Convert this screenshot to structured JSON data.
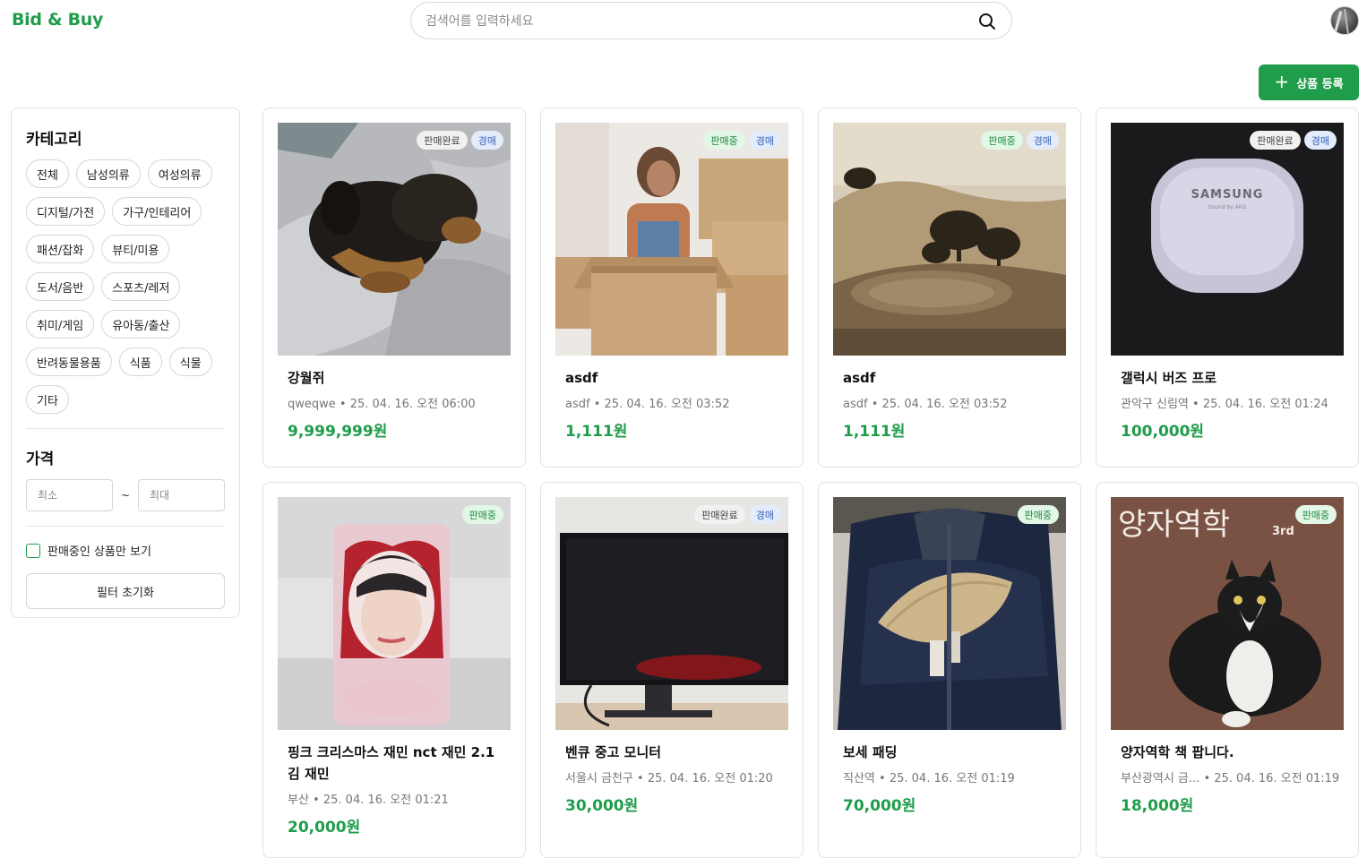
{
  "header": {
    "logo": "Bid & Buy",
    "search_placeholder": "검색어를 입력하세요",
    "search_icon": "search-icon",
    "avatar_icon": "avatar"
  },
  "register_button": {
    "label": "상품 등록",
    "icon": "plus-icon"
  },
  "sidebar": {
    "category_title": "카테고리",
    "categories": [
      "전체",
      "남성의류",
      "여성의류",
      "디지털/가전",
      "가구/인테리어",
      "패션/잡화",
      "뷰티/미용",
      "도서/음반",
      "스포츠/레저",
      "취미/게임",
      "유아동/출산",
      "반려동물용품",
      "식품",
      "식물",
      "기타"
    ],
    "price_title": "가격",
    "price_min_placeholder": "최소",
    "price_max_placeholder": "최대",
    "price_separator": "~",
    "on_sale_only_label": "판매중인 상품만 보기",
    "reset_label": "필터 초기화"
  },
  "products": [
    {
      "title": "강월쥐",
      "seller": "qweqwe",
      "date": "25. 04. 16. 오전 06:00",
      "price": "9,999,999원",
      "badges": [
        "판매완료",
        "경매"
      ]
    },
    {
      "title": "asdf",
      "seller": "asdf",
      "date": "25. 04. 16. 오전 03:52",
      "price": "1,111원",
      "badges": [
        "판매중",
        "경매"
      ]
    },
    {
      "title": "asdf",
      "seller": "asdf",
      "date": "25. 04. 16. 오전 03:52",
      "price": "1,111원",
      "badges": [
        "판매중",
        "경매"
      ]
    },
    {
      "title": "갤럭시 버즈 프로",
      "seller": "관악구 신림역",
      "date": "25. 04. 16. 오전 01:24",
      "price": "100,000원",
      "badges": [
        "판매완료",
        "경매"
      ]
    },
    {
      "title": "핑크 크리스마스 재민 nct 재민 2.1 김 재민",
      "seller": "부산",
      "date": "25. 04. 16. 오전 01:21",
      "price": "20,000원",
      "badges": [
        "판매중"
      ]
    },
    {
      "title": "벤큐 중고 모니터",
      "seller": "서울시 금천구",
      "date": "25. 04. 16. 오전 01:20",
      "price": "30,000원",
      "badges": [
        "판매완료",
        "경매"
      ]
    },
    {
      "title": "보세 패딩",
      "seller": "직산역",
      "date": "25. 04. 16. 오전 01:19",
      "price": "70,000원",
      "badges": [
        "판매중"
      ]
    },
    {
      "title": "양자역학 책 팝니다.",
      "seller": "부산광역시 금...",
      "date": "25. 04. 16. 오전 01:19",
      "price": "18,000원",
      "badges": [
        "판매중"
      ]
    }
  ],
  "image_text": {
    "samsung_logo": "SAMSUNG",
    "samsung_sub": "Sound by AKG",
    "book_cover_title": "양자역학",
    "book_edition": "3rd"
  },
  "meta_separator": "•",
  "colors": {
    "brand": "#1f9d4a",
    "badge_onsale": "#e3f7e7",
    "badge_auction": "#e3ecfb",
    "badge_done": "#f1f1f1"
  }
}
